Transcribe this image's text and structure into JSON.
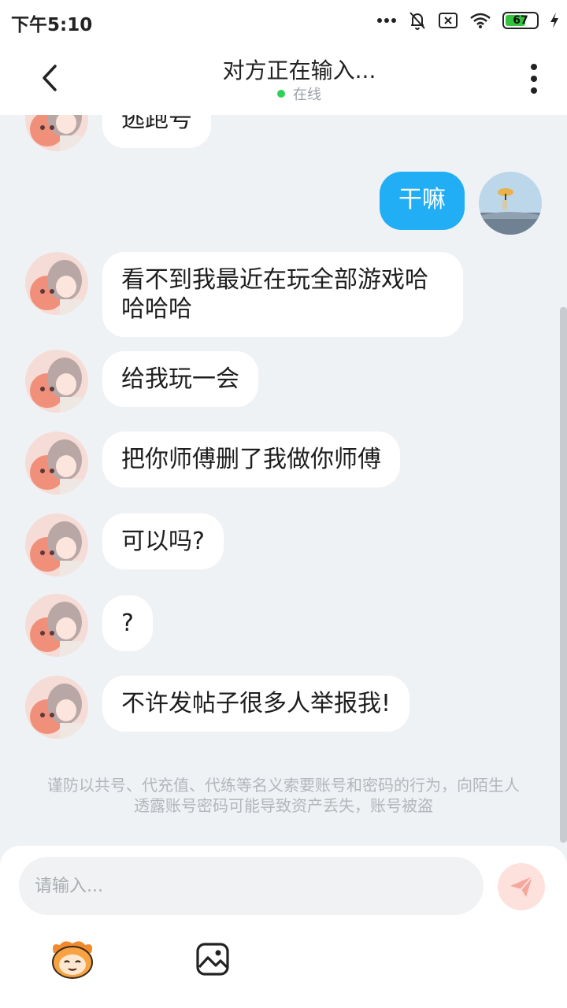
{
  "status_bar": {
    "time": "下午5:10",
    "battery": "67"
  },
  "header": {
    "title": "对方正在输入...",
    "online": "在线"
  },
  "messages": [
    {
      "side": "left",
      "text": "逃跑号"
    },
    {
      "side": "right",
      "text": "干嘛"
    },
    {
      "side": "left",
      "text": "看不到我最近在玩全部游戏哈哈哈哈"
    },
    {
      "side": "left",
      "text": "给我玩一会"
    },
    {
      "side": "left",
      "text": "把你师傅删了我做你师傅"
    },
    {
      "side": "left",
      "text": "可以吗?"
    },
    {
      "side": "left",
      "text": "?"
    },
    {
      "side": "left",
      "text": "不许发帖子很多人举报我!"
    }
  ],
  "notice": "谨防以共号、代充值、代练等名义索要账号和密码的行为，向陌生人透露账号密码可能导致资产丢失，账号被盗",
  "composer": {
    "placeholder": "请输入..."
  },
  "colors": {
    "accent": "#21aef4",
    "online": "#2fd05a",
    "send_bg": "#fde1dd",
    "send_icon": "#f5a79b"
  },
  "icons": [
    "back-icon",
    "more-icon",
    "send-icon",
    "emoji-icon",
    "image-icon",
    "wifi-icon",
    "mute-icon",
    "battery-icon"
  ]
}
